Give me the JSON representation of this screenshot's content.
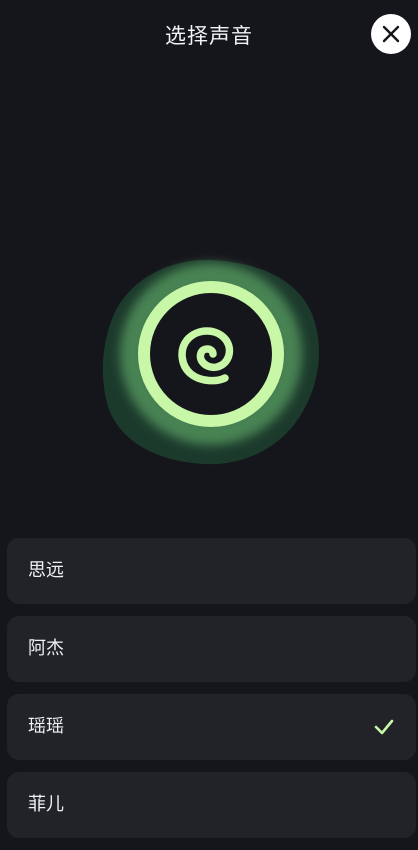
{
  "header": {
    "title": "选择声音",
    "close_icon": "close-icon"
  },
  "visualizer": {
    "icon": "voice-orb-spiral",
    "accent_color": "#c8f7a8",
    "glow_color": "#1c3a2c"
  },
  "voices": [
    {
      "label": "思远",
      "selected": false
    },
    {
      "label": "阿杰",
      "selected": false
    },
    {
      "label": "瑶瑶",
      "selected": true
    },
    {
      "label": "菲儿",
      "selected": false
    }
  ],
  "selected_icon": "checkmark-icon"
}
